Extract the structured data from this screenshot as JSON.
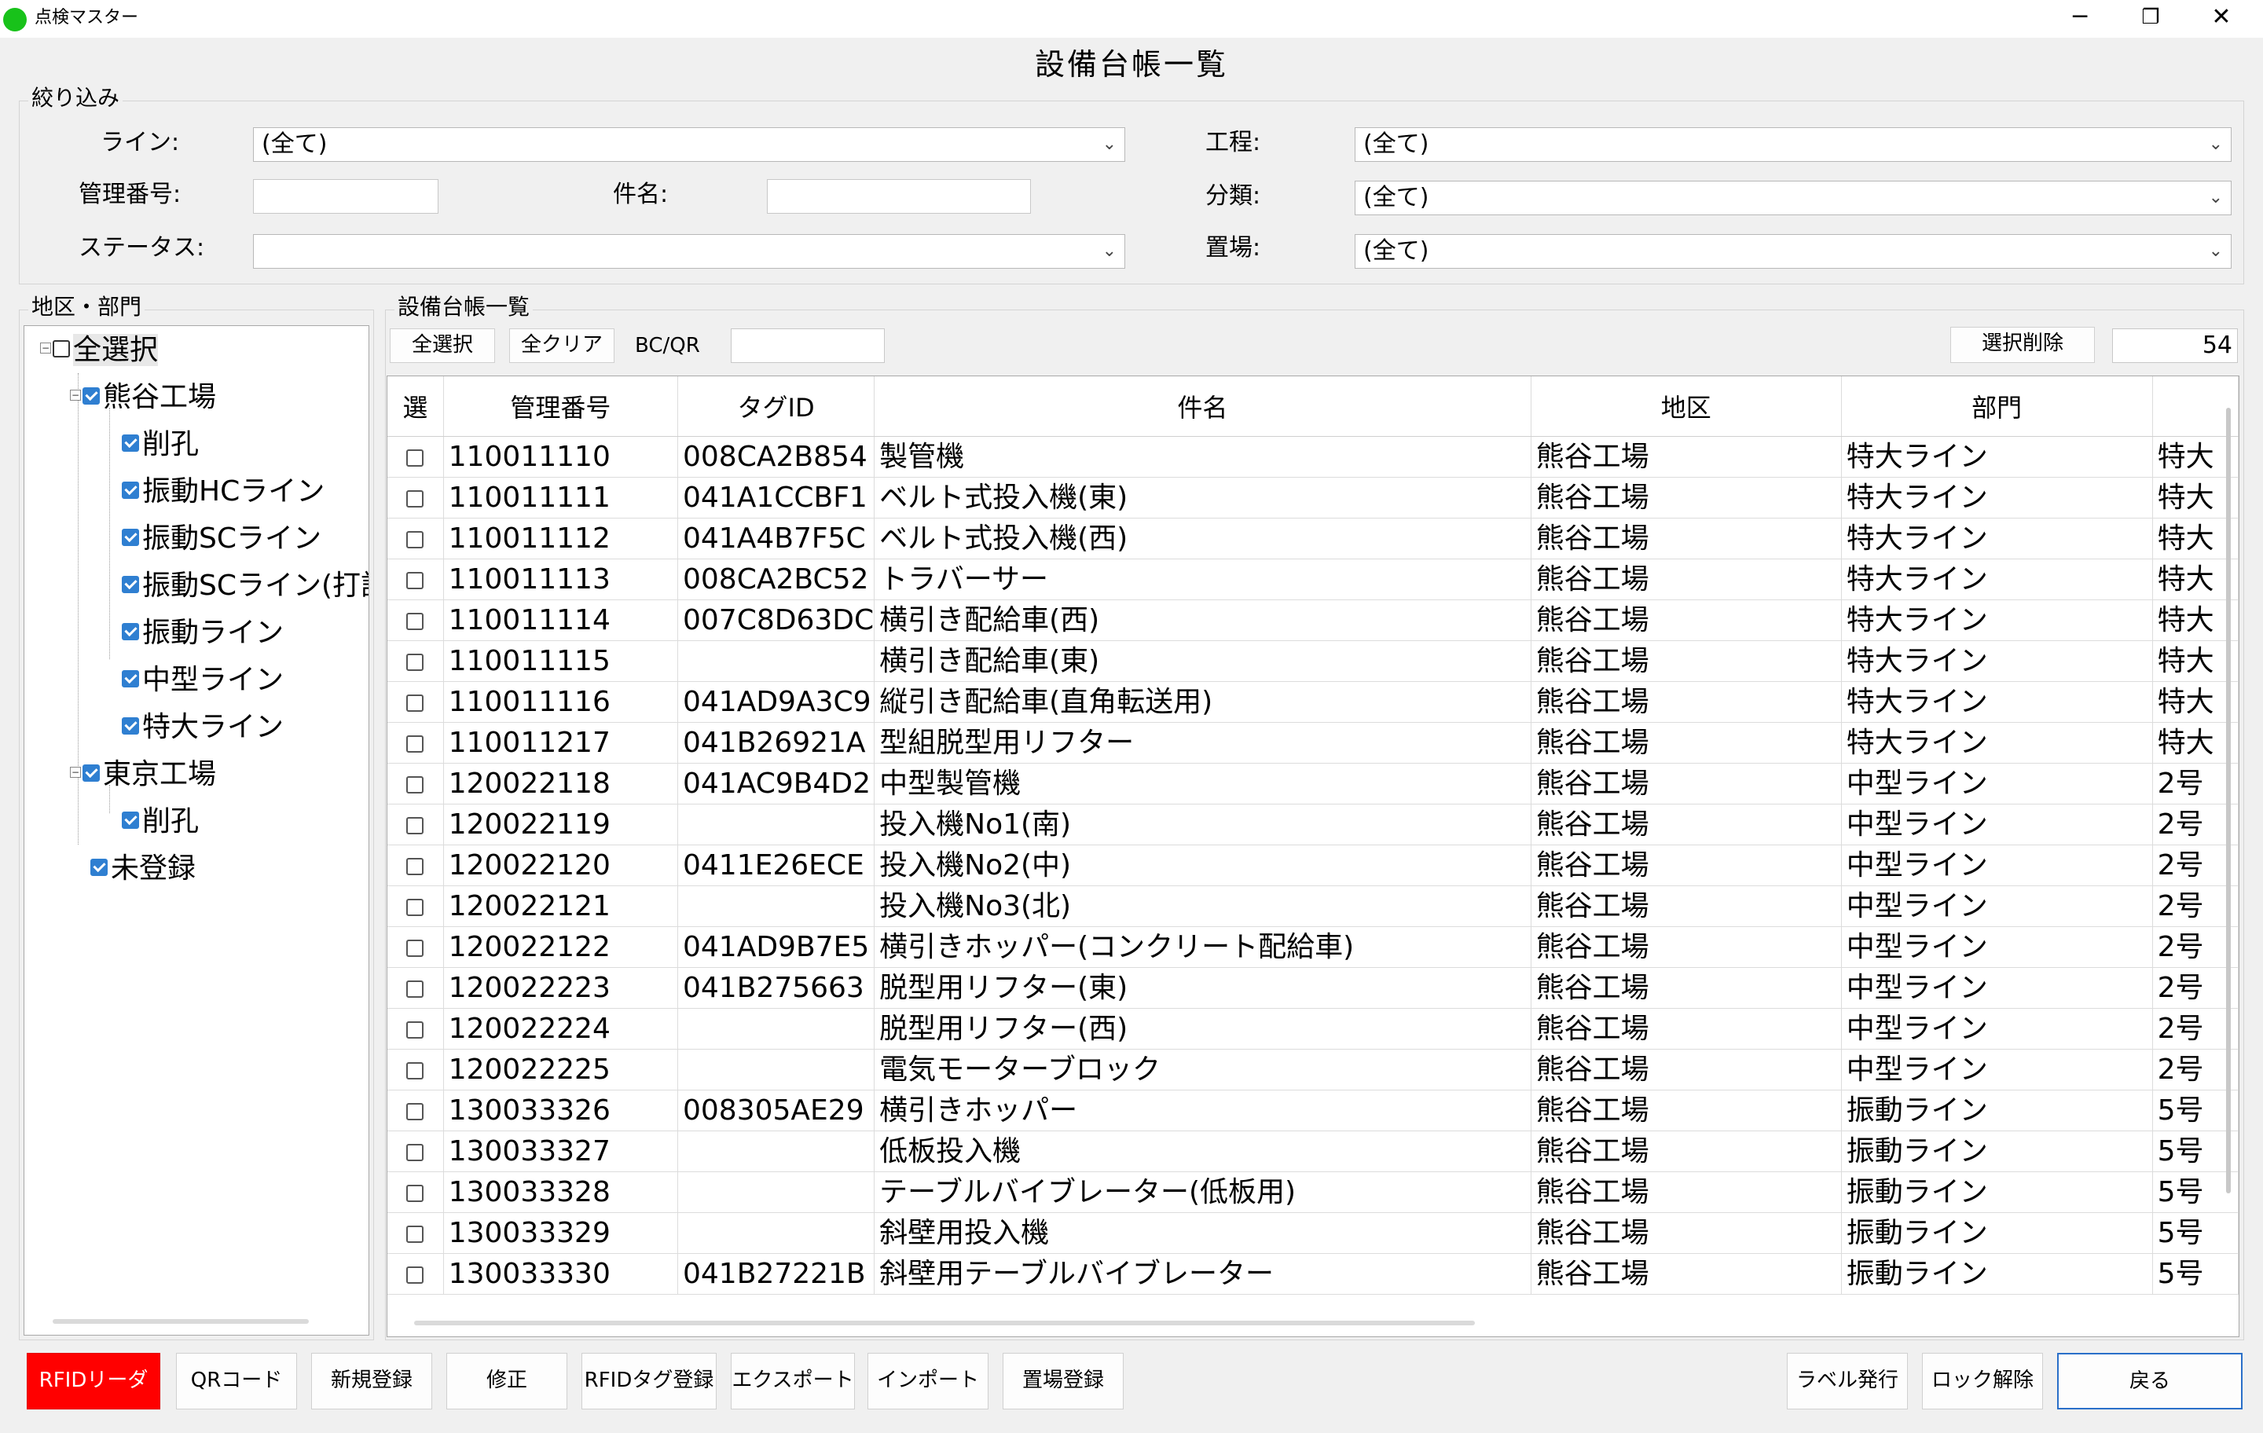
{
  "window": {
    "app_title": "点検マスター",
    "minimize_glyph": "─",
    "restore_glyph": "❐",
    "close_glyph": "✕"
  },
  "page_title": "設備台帳一覧",
  "filter": {
    "group_label": "絞り込み",
    "line_label": "ライン:",
    "line_value": "(全て)",
    "kanri_label": "管理番号:",
    "kanri_value": "",
    "kenmei_label": "件名:",
    "kenmei_value": "",
    "status_label": "ステータス:",
    "status_value": "",
    "koutei_label": "工程:",
    "koutei_value": "(全て)",
    "bunrui_label": "分類:",
    "bunrui_value": "(全て)",
    "okiba_label": "置場:",
    "okiba_value": "(全て)",
    "dropdown_glyph": "⌄"
  },
  "tree": {
    "group_label": "地区・部門",
    "root": "全選択",
    "kumagaya": "熊谷工場",
    "kumagaya_children": [
      "削孔",
      "振動HCライン",
      "振動SCライン",
      "振動SCライン(打設",
      "振動ライン",
      "中型ライン",
      "特大ライン"
    ],
    "tokyo": "東京工場",
    "tokyo_children": [
      "削孔"
    ],
    "unregistered": "未登録"
  },
  "list": {
    "group_label": "設備台帳一覧",
    "select_all": "全選択",
    "clear_all": "全クリア",
    "bcqr_label": "BC/QR",
    "bcqr_value": "",
    "delete_selected": "選択削除",
    "count": "54",
    "columns": [
      "選",
      "管理番号",
      "タグID",
      "件名",
      "地区",
      "部門",
      ""
    ],
    "rows": [
      [
        "110011110",
        "008CA2B854",
        "製管機",
        "熊谷工場",
        "特大ライン",
        "特大"
      ],
      [
        "110011111",
        "041A1CCBF1",
        "ベルト式投入機(東)",
        "熊谷工場",
        "特大ライン",
        "特大"
      ],
      [
        "110011112",
        "041A4B7F5C",
        "ベルト式投入機(西)",
        "熊谷工場",
        "特大ライン",
        "特大"
      ],
      [
        "110011113",
        "008CA2BC52",
        "トラバーサー",
        "熊谷工場",
        "特大ライン",
        "特大"
      ],
      [
        "110011114",
        "007C8D63DC",
        "横引き配給車(西)",
        "熊谷工場",
        "特大ライン",
        "特大"
      ],
      [
        "110011115",
        "",
        "横引き配給車(東)",
        "熊谷工場",
        "特大ライン",
        "特大"
      ],
      [
        "110011116",
        "041AD9A3C9",
        "縦引き配給車(直角転送用)",
        "熊谷工場",
        "特大ライン",
        "特大"
      ],
      [
        "110011217",
        "041B26921A",
        "型組脱型用リフター",
        "熊谷工場",
        "特大ライン",
        "特大"
      ],
      [
        "120022118",
        "041AC9B4D2",
        "中型製管機",
        "熊谷工場",
        "中型ライン",
        "2号"
      ],
      [
        "120022119",
        "",
        "投入機No1(南)",
        "熊谷工場",
        "中型ライン",
        "2号"
      ],
      [
        "120022120",
        "0411E26ECE",
        "投入機No2(中)",
        "熊谷工場",
        "中型ライン",
        "2号"
      ],
      [
        "120022121",
        "",
        "投入機No3(北)",
        "熊谷工場",
        "中型ライン",
        "2号"
      ],
      [
        "120022122",
        "041AD9B7E5",
        "横引きホッパー(コンクリート配給車)",
        "熊谷工場",
        "中型ライン",
        "2号"
      ],
      [
        "120022223",
        "041B275663",
        "脱型用リフター(東)",
        "熊谷工場",
        "中型ライン",
        "2号"
      ],
      [
        "120022224",
        "",
        "脱型用リフター(西)",
        "熊谷工場",
        "中型ライン",
        "2号"
      ],
      [
        "120022225",
        "",
        "電気モーターブロック",
        "熊谷工場",
        "中型ライン",
        "2号"
      ],
      [
        "130033326",
        "008305AE29",
        "横引きホッパー",
        "熊谷工場",
        "振動ライン",
        "5号"
      ],
      [
        "130033327",
        "",
        "低板投入機",
        "熊谷工場",
        "振動ライン",
        "5号"
      ],
      [
        "130033328",
        "",
        "テーブルバイブレーター(低板用)",
        "熊谷工場",
        "振動ライン",
        "5号"
      ],
      [
        "130033329",
        "",
        "斜壁用投入機",
        "熊谷工場",
        "振動ライン",
        "5号"
      ],
      [
        "130033330",
        "041B27221B",
        "斜壁用テーブルバイブレーター",
        "熊谷工場",
        "振動ライン",
        "5号"
      ]
    ]
  },
  "buttons": {
    "rfid_reader": "RFIDリーダ",
    "qr_code": "QRコード",
    "new_register": "新規登録",
    "edit": "修正",
    "rfid_tag_register": "RFIDタグ登録",
    "export": "エクスポート",
    "import": "インポート",
    "okiba_register": "置場登録",
    "label_issue": "ラベル発行",
    "unlock": "ロック解除",
    "back": "戻る"
  },
  "colors": {
    "rfid_button_bg": "#ff0000",
    "back_button_border": "#2a6fc9",
    "checkbox_checked": "#2f7fd1",
    "app_icon": "#18c21a"
  }
}
